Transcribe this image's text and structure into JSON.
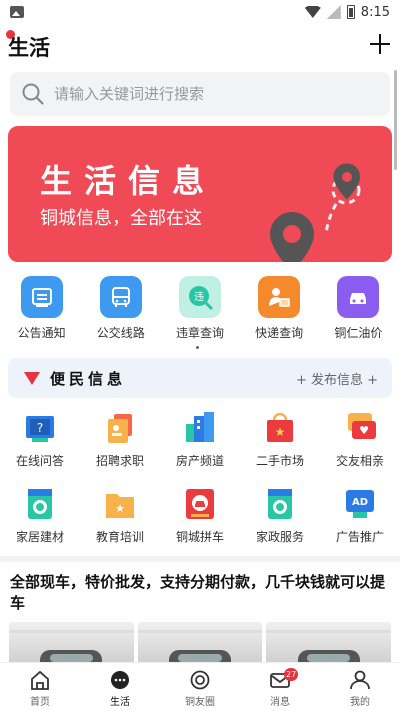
{
  "status_bar": {
    "time": "8:15"
  },
  "header": {
    "title": "生活"
  },
  "search": {
    "placeholder": "请输入关键词进行搜索"
  },
  "banner": {
    "title": "生活信息",
    "subtitle": "铜城信息，全部在这"
  },
  "quick_items": [
    {
      "label": "公告通知",
      "icon": "announcement-icon",
      "color": "#3d9af0"
    },
    {
      "label": "公交线路",
      "icon": "bus-icon",
      "color": "#3d9af0"
    },
    {
      "label": "违章查询",
      "icon": "violation-query-icon",
      "color": "#27c7a6"
    },
    {
      "label": "快递查询",
      "icon": "courier-icon",
      "color": "#f58a2c"
    },
    {
      "label": "铜仁油价",
      "icon": "car-fuel-icon",
      "color": "#8a5cf0"
    }
  ],
  "section": {
    "title": "便民信息",
    "publish": "+ 发布信息 +"
  },
  "grid_items": [
    {
      "label": "在线问答",
      "icon": "qa-book-icon"
    },
    {
      "label": "招聘求职",
      "icon": "recruit-icon"
    },
    {
      "label": "房产频道",
      "icon": "building-icon"
    },
    {
      "label": "二手市场",
      "icon": "shopping-bag-icon"
    },
    {
      "label": "交友相亲",
      "icon": "chat-heart-icon"
    },
    {
      "label": "家居建材",
      "icon": "washing-machine-icon"
    },
    {
      "label": "教育培训",
      "icon": "folder-star-icon"
    },
    {
      "label": "铜城拼车",
      "icon": "carpool-icon"
    },
    {
      "label": "家政服务",
      "icon": "housekeeping-icon"
    },
    {
      "label": "广告推广",
      "icon": "ad-icon"
    }
  ],
  "post": {
    "title": "全部现车，特价批发，支持分期付款，几千块钱就可以提车"
  },
  "tabs": [
    {
      "label": "首页",
      "icon": "home-icon"
    },
    {
      "label": "生活",
      "icon": "life-chat-icon",
      "active": true
    },
    {
      "label": "铜友圈",
      "icon": "circle-icon"
    },
    {
      "label": "消息",
      "icon": "mail-icon",
      "badge": "27"
    },
    {
      "label": "我的",
      "icon": "profile-icon"
    }
  ]
}
